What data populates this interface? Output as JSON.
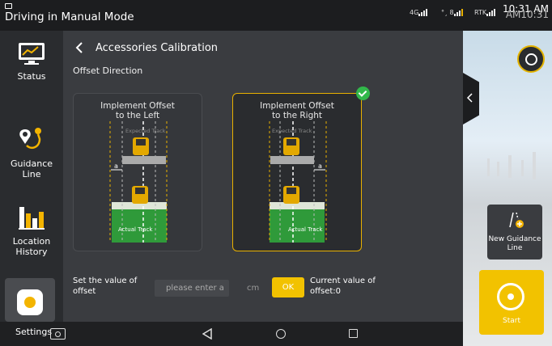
{
  "statusbar": {
    "title": "Driving in Manual Mode",
    "net_4g": "4G",
    "net_sat": "°¸ 8",
    "net_rtk": "RTK",
    "time": "10:31 AM",
    "time_ghost": "AM10:31"
  },
  "leftnav": {
    "items": [
      {
        "label": "Status",
        "icon": "monitor-chart-icon"
      },
      {
        "label": "Guidance Line",
        "icon": "route-pin-icon"
      },
      {
        "label": "Location History",
        "icon": "bar-chart-icon"
      },
      {
        "label": "Settings",
        "icon": "gear-icon"
      }
    ]
  },
  "main": {
    "title": "Accessories Calibration",
    "section_label": "Offset Direction",
    "options": [
      {
        "title_line1": "Implement Offset",
        "title_line2": "to the Left",
        "expected": "Expected Track",
        "actual": "Actual Track",
        "offset_symbol": "a",
        "selected": false
      },
      {
        "title_line1": "Implement Offset",
        "title_line2": "to the Right",
        "expected": "Expected Track",
        "actual": "Actual Track",
        "offset_symbol": "a",
        "selected": true
      }
    ],
    "offset_label_line1": "Set the value of",
    "offset_label_line2": "offset",
    "offset_placeholder": "please enter a",
    "offset_value": "",
    "unit": "cm",
    "ok_label": "OK",
    "current_line1": "Current value of",
    "current_line2": "offset:0"
  },
  "right": {
    "new_guidance_line1": "New Guidance",
    "new_guidance_line2": "Line",
    "start_label": "Start"
  },
  "colors": {
    "accent": "#f2c200",
    "selected_check": "#31b84a",
    "field_green": "#2f9a3a"
  }
}
